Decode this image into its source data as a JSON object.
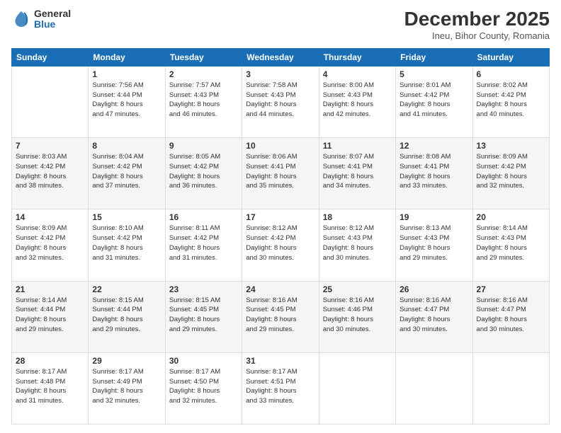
{
  "logo": {
    "general": "General",
    "blue": "Blue"
  },
  "header": {
    "month_title": "December 2025",
    "location": "Ineu, Bihor County, Romania"
  },
  "days_of_week": [
    "Sunday",
    "Monday",
    "Tuesday",
    "Wednesday",
    "Thursday",
    "Friday",
    "Saturday"
  ],
  "weeks": [
    [
      {
        "day": "",
        "info": ""
      },
      {
        "day": "1",
        "info": "Sunrise: 7:56 AM\nSunset: 4:44 PM\nDaylight: 8 hours\nand 47 minutes."
      },
      {
        "day": "2",
        "info": "Sunrise: 7:57 AM\nSunset: 4:43 PM\nDaylight: 8 hours\nand 46 minutes."
      },
      {
        "day": "3",
        "info": "Sunrise: 7:58 AM\nSunset: 4:43 PM\nDaylight: 8 hours\nand 44 minutes."
      },
      {
        "day": "4",
        "info": "Sunrise: 8:00 AM\nSunset: 4:43 PM\nDaylight: 8 hours\nand 42 minutes."
      },
      {
        "day": "5",
        "info": "Sunrise: 8:01 AM\nSunset: 4:42 PM\nDaylight: 8 hours\nand 41 minutes."
      },
      {
        "day": "6",
        "info": "Sunrise: 8:02 AM\nSunset: 4:42 PM\nDaylight: 8 hours\nand 40 minutes."
      }
    ],
    [
      {
        "day": "7",
        "info": "Sunrise: 8:03 AM\nSunset: 4:42 PM\nDaylight: 8 hours\nand 38 minutes."
      },
      {
        "day": "8",
        "info": "Sunrise: 8:04 AM\nSunset: 4:42 PM\nDaylight: 8 hours\nand 37 minutes."
      },
      {
        "day": "9",
        "info": "Sunrise: 8:05 AM\nSunset: 4:42 PM\nDaylight: 8 hours\nand 36 minutes."
      },
      {
        "day": "10",
        "info": "Sunrise: 8:06 AM\nSunset: 4:41 PM\nDaylight: 8 hours\nand 35 minutes."
      },
      {
        "day": "11",
        "info": "Sunrise: 8:07 AM\nSunset: 4:41 PM\nDaylight: 8 hours\nand 34 minutes."
      },
      {
        "day": "12",
        "info": "Sunrise: 8:08 AM\nSunset: 4:41 PM\nDaylight: 8 hours\nand 33 minutes."
      },
      {
        "day": "13",
        "info": "Sunrise: 8:09 AM\nSunset: 4:42 PM\nDaylight: 8 hours\nand 32 minutes."
      }
    ],
    [
      {
        "day": "14",
        "info": "Sunrise: 8:09 AM\nSunset: 4:42 PM\nDaylight: 8 hours\nand 32 minutes."
      },
      {
        "day": "15",
        "info": "Sunrise: 8:10 AM\nSunset: 4:42 PM\nDaylight: 8 hours\nand 31 minutes."
      },
      {
        "day": "16",
        "info": "Sunrise: 8:11 AM\nSunset: 4:42 PM\nDaylight: 8 hours\nand 31 minutes."
      },
      {
        "day": "17",
        "info": "Sunrise: 8:12 AM\nSunset: 4:42 PM\nDaylight: 8 hours\nand 30 minutes."
      },
      {
        "day": "18",
        "info": "Sunrise: 8:12 AM\nSunset: 4:43 PM\nDaylight: 8 hours\nand 30 minutes."
      },
      {
        "day": "19",
        "info": "Sunrise: 8:13 AM\nSunset: 4:43 PM\nDaylight: 8 hours\nand 29 minutes."
      },
      {
        "day": "20",
        "info": "Sunrise: 8:14 AM\nSunset: 4:43 PM\nDaylight: 8 hours\nand 29 minutes."
      }
    ],
    [
      {
        "day": "21",
        "info": "Sunrise: 8:14 AM\nSunset: 4:44 PM\nDaylight: 8 hours\nand 29 minutes."
      },
      {
        "day": "22",
        "info": "Sunrise: 8:15 AM\nSunset: 4:44 PM\nDaylight: 8 hours\nand 29 minutes."
      },
      {
        "day": "23",
        "info": "Sunrise: 8:15 AM\nSunset: 4:45 PM\nDaylight: 8 hours\nand 29 minutes."
      },
      {
        "day": "24",
        "info": "Sunrise: 8:16 AM\nSunset: 4:45 PM\nDaylight: 8 hours\nand 29 minutes."
      },
      {
        "day": "25",
        "info": "Sunrise: 8:16 AM\nSunset: 4:46 PM\nDaylight: 8 hours\nand 30 minutes."
      },
      {
        "day": "26",
        "info": "Sunrise: 8:16 AM\nSunset: 4:47 PM\nDaylight: 8 hours\nand 30 minutes."
      },
      {
        "day": "27",
        "info": "Sunrise: 8:16 AM\nSunset: 4:47 PM\nDaylight: 8 hours\nand 30 minutes."
      }
    ],
    [
      {
        "day": "28",
        "info": "Sunrise: 8:17 AM\nSunset: 4:48 PM\nDaylight: 8 hours\nand 31 minutes."
      },
      {
        "day": "29",
        "info": "Sunrise: 8:17 AM\nSunset: 4:49 PM\nDaylight: 8 hours\nand 32 minutes."
      },
      {
        "day": "30",
        "info": "Sunrise: 8:17 AM\nSunset: 4:50 PM\nDaylight: 8 hours\nand 32 minutes."
      },
      {
        "day": "31",
        "info": "Sunrise: 8:17 AM\nSunset: 4:51 PM\nDaylight: 8 hours\nand 33 minutes."
      },
      {
        "day": "",
        "info": ""
      },
      {
        "day": "",
        "info": ""
      },
      {
        "day": "",
        "info": ""
      }
    ]
  ]
}
